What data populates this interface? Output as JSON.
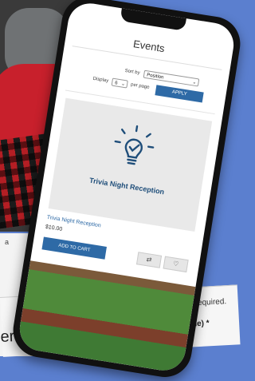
{
  "page": {
    "title": "Events"
  },
  "controls": {
    "sort_label": "Sort by",
    "sort_value": "Position",
    "display_label": "Display",
    "display_value": "6",
    "per_page_label": "per page",
    "apply_label": "APPLY"
  },
  "product": {
    "image_caption": "Trivia Night Reception",
    "name": "Trivia Night Reception",
    "price": "$10.00",
    "add_to_cart_label": "ADD TO CART",
    "compare_icon": "compare-icon",
    "wishlist_icon": "heart-icon"
  },
  "background": {
    "left_snippet": "a",
    "bottom_heading": "er",
    "required_note": "sk are required.",
    "field_label": "ull name) *"
  },
  "colors": {
    "accent": "#2e6aa6",
    "background": "#5b7fcf",
    "card_bg": "#e9e9e9",
    "title_text": "#1f4e7a"
  }
}
